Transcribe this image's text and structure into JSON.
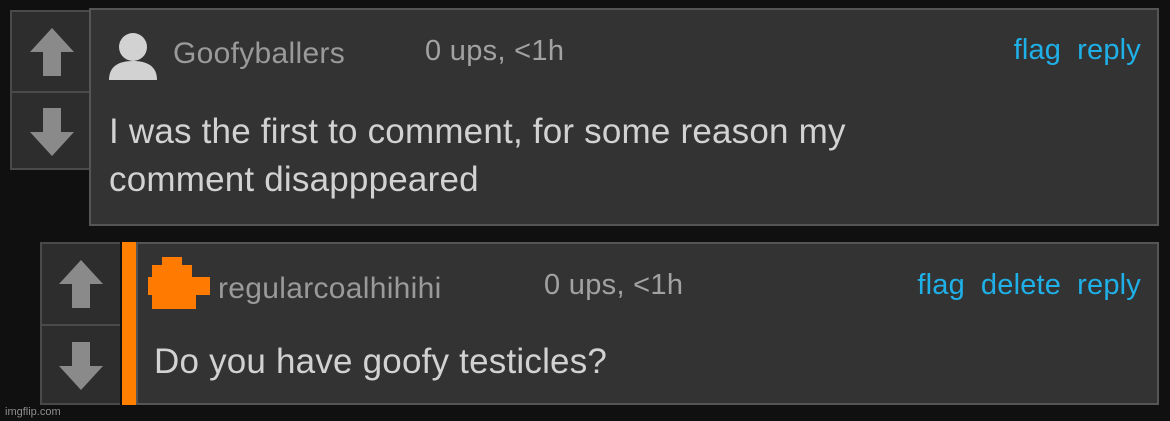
{
  "comments": [
    {
      "username": "Goofyballers",
      "meta": "0 ups, <1h",
      "actions": [
        "flag",
        "reply"
      ],
      "text_lines": [
        "I was the first to comment, for some reason my",
        "comment disapppeared"
      ],
      "avatar": "default-user-icon"
    },
    {
      "username": "regularcoalhihihi",
      "meta": "0 ups, <1h",
      "actions": [
        "flag",
        "delete",
        "reply"
      ],
      "text_lines": [
        "Do you have goofy testicles?"
      ],
      "avatar": "custom-pixel-avatar",
      "op_marker_color": "#ff8000"
    }
  ],
  "watermark": "imgflip.com",
  "colors": {
    "background": "#101010",
    "panel": "#333333",
    "link": "#1fb0e8",
    "op_marker": "#ff8000",
    "arrow": "#8a8a8a"
  },
  "icons": {
    "upvote": "arrow-up-icon",
    "downvote": "arrow-down-icon"
  }
}
